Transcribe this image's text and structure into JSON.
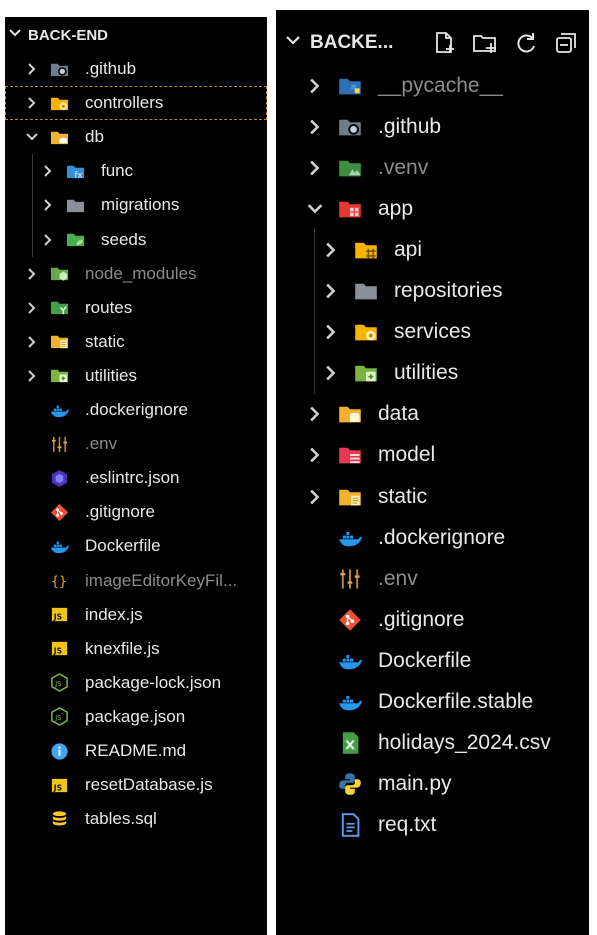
{
  "left_panel": {
    "title": "BACK-END",
    "items": [
      {
        "name": ".github",
        "type": "folder",
        "depth": 0,
        "expanded": false,
        "icon": "github-folder-icon"
      },
      {
        "name": "controllers",
        "type": "folder",
        "depth": 0,
        "expanded": false,
        "icon": "controllers-folder-icon",
        "selected": true
      },
      {
        "name": "db",
        "type": "folder",
        "depth": 0,
        "expanded": true,
        "icon": "db-folder-icon"
      },
      {
        "name": "func",
        "type": "folder",
        "depth": 1,
        "expanded": false,
        "icon": "func-folder-icon"
      },
      {
        "name": "migrations",
        "type": "folder",
        "depth": 1,
        "expanded": false,
        "icon": "folder-icon"
      },
      {
        "name": "seeds",
        "type": "folder",
        "depth": 1,
        "expanded": false,
        "icon": "seeds-folder-icon"
      },
      {
        "name": "node_modules",
        "type": "folder",
        "depth": 0,
        "expanded": false,
        "icon": "node-modules-folder-icon",
        "dim": true
      },
      {
        "name": "routes",
        "type": "folder",
        "depth": 0,
        "expanded": false,
        "icon": "routes-folder-icon"
      },
      {
        "name": "static",
        "type": "folder",
        "depth": 0,
        "expanded": false,
        "icon": "static-folder-icon"
      },
      {
        "name": "utilities",
        "type": "folder",
        "depth": 0,
        "expanded": false,
        "icon": "utilities-folder-icon"
      },
      {
        "name": ".dockerignore",
        "type": "file",
        "depth": 0,
        "icon": "docker-icon"
      },
      {
        "name": ".env",
        "type": "file",
        "depth": 0,
        "icon": "env-icon",
        "dim": true
      },
      {
        "name": ".eslintrc.json",
        "type": "file",
        "depth": 0,
        "icon": "eslint-icon"
      },
      {
        "name": ".gitignore",
        "type": "file",
        "depth": 0,
        "icon": "git-icon"
      },
      {
        "name": "Dockerfile",
        "type": "file",
        "depth": 0,
        "icon": "docker-icon"
      },
      {
        "name": "imageEditorKeyFil...",
        "type": "file",
        "depth": 0,
        "icon": "json-braces-icon",
        "dim": true
      },
      {
        "name": "index.js",
        "type": "file",
        "depth": 0,
        "icon": "js-icon"
      },
      {
        "name": "knexfile.js",
        "type": "file",
        "depth": 0,
        "icon": "js-icon"
      },
      {
        "name": "package-lock.json",
        "type": "file",
        "depth": 0,
        "icon": "nodejs-icon"
      },
      {
        "name": "package.json",
        "type": "file",
        "depth": 0,
        "icon": "nodejs-icon"
      },
      {
        "name": "README.md",
        "type": "file",
        "depth": 0,
        "icon": "info-icon"
      },
      {
        "name": "resetDatabase.js",
        "type": "file",
        "depth": 0,
        "icon": "js-icon"
      },
      {
        "name": "tables.sql",
        "type": "file",
        "depth": 0,
        "icon": "database-icon"
      }
    ]
  },
  "right_panel": {
    "title": "BACKE...",
    "actions": [
      {
        "name": "new-file",
        "icon": "new-file-icon"
      },
      {
        "name": "new-folder",
        "icon": "new-folder-icon"
      },
      {
        "name": "refresh",
        "icon": "refresh-icon"
      },
      {
        "name": "collapse-all",
        "icon": "collapse-all-icon"
      }
    ],
    "items": [
      {
        "name": "__pycache__",
        "type": "folder",
        "depth": 0,
        "expanded": false,
        "icon": "pycache-folder-icon",
        "dim": true
      },
      {
        "name": ".github",
        "type": "folder",
        "depth": 0,
        "expanded": false,
        "icon": "github-folder-icon"
      },
      {
        "name": ".venv",
        "type": "folder",
        "depth": 0,
        "expanded": false,
        "icon": "venv-folder-icon",
        "dim": true
      },
      {
        "name": "app",
        "type": "folder",
        "depth": 0,
        "expanded": true,
        "icon": "app-folder-icon"
      },
      {
        "name": "api",
        "type": "folder",
        "depth": 1,
        "expanded": false,
        "icon": "api-folder-icon"
      },
      {
        "name": "repositories",
        "type": "folder",
        "depth": 1,
        "expanded": false,
        "icon": "folder-icon"
      },
      {
        "name": "services",
        "type": "folder",
        "depth": 1,
        "expanded": false,
        "icon": "services-folder-icon"
      },
      {
        "name": "utilities",
        "type": "folder",
        "depth": 1,
        "expanded": false,
        "icon": "utilities-folder-icon"
      },
      {
        "name": "data",
        "type": "folder",
        "depth": 0,
        "expanded": false,
        "icon": "data-folder-icon"
      },
      {
        "name": "model",
        "type": "folder",
        "depth": 0,
        "expanded": false,
        "icon": "model-folder-icon"
      },
      {
        "name": "static",
        "type": "folder",
        "depth": 0,
        "expanded": false,
        "icon": "static-folder-icon"
      },
      {
        "name": ".dockerignore",
        "type": "file",
        "depth": 0,
        "icon": "docker-icon"
      },
      {
        "name": ".env",
        "type": "file",
        "depth": 0,
        "icon": "env-icon",
        "dim": true
      },
      {
        "name": ".gitignore",
        "type": "file",
        "depth": 0,
        "icon": "git-icon"
      },
      {
        "name": "Dockerfile",
        "type": "file",
        "depth": 0,
        "icon": "docker-icon"
      },
      {
        "name": "Dockerfile.stable",
        "type": "file",
        "depth": 0,
        "icon": "docker-icon"
      },
      {
        "name": "holidays_2024.csv",
        "type": "file",
        "depth": 0,
        "icon": "csv-icon"
      },
      {
        "name": "main.py",
        "type": "file",
        "depth": 0,
        "icon": "python-icon"
      },
      {
        "name": "req.txt",
        "type": "file",
        "depth": 0,
        "icon": "text-file-icon"
      }
    ]
  },
  "colors": {
    "background": "#000000",
    "text": "#e8e8e8",
    "dim_text": "#8c8c8c",
    "selection_outline": "#b8862b"
  }
}
